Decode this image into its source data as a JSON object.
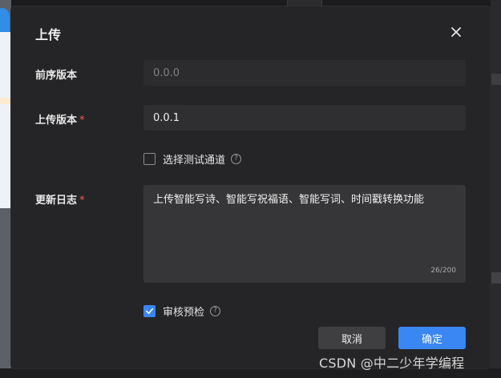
{
  "dialog": {
    "title": "上传",
    "fields": {
      "prev_version": {
        "label": "前序版本",
        "value": "0.0.0"
      },
      "upload_version": {
        "label": "上传版本",
        "required_mark": "*",
        "value": "0.0.1"
      },
      "test_channel": {
        "label": "选择测试通道",
        "checked": false
      },
      "changelog": {
        "label": "更新日志",
        "required_mark": "*",
        "value": "上传智能写诗、智能写祝福语、智能写词、时间戳转换功能",
        "counter": "26/200"
      },
      "review_precheck": {
        "label": "审核预检",
        "checked": true
      }
    },
    "buttons": {
      "cancel": "取消",
      "confirm": "确定"
    }
  },
  "watermark": "CSDN @中二少年学编程",
  "colors": {
    "accent": "#3a86f2",
    "required": "#f35b5b",
    "modal_bg": "#252527"
  },
  "icons": {
    "close": "close-icon",
    "help": "help-icon",
    "check": "checkmark-icon"
  }
}
